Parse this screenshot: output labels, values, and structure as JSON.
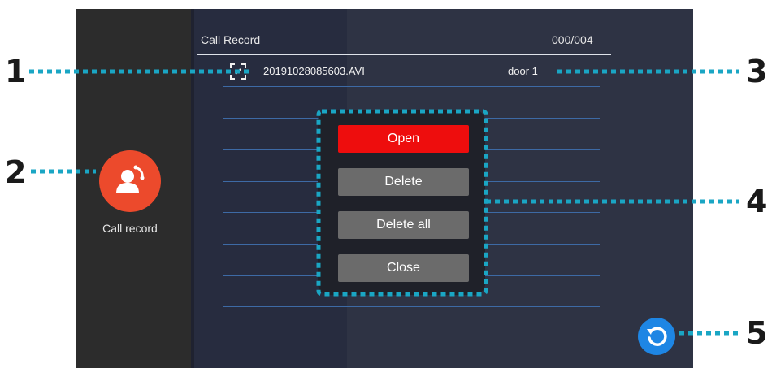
{
  "sidebar": {
    "icon": "call-record-person-icon",
    "label": "Call record"
  },
  "header": {
    "title": "Call Record",
    "count": "000/004"
  },
  "records": [
    {
      "icon": "video-file-frame-icon",
      "filename": "20191028085603.AVI",
      "source": "door 1"
    }
  ],
  "popup": {
    "buttons": [
      {
        "label": "Open",
        "color": "#ee0d0d"
      },
      {
        "label": "Delete",
        "color": "#6b6b6b"
      },
      {
        "label": "Delete all",
        "color": "#6b6b6b"
      },
      {
        "label": "Close",
        "color": "#6b6b6b"
      }
    ]
  },
  "refresh": {
    "icon": "refresh-icon"
  },
  "callouts": [
    "1",
    "2",
    "3",
    "4",
    "5"
  ],
  "colors": {
    "callout": "#1aa6c4",
    "accent_red": "#ec4a2c",
    "accent_blue": "#1e86e4"
  }
}
